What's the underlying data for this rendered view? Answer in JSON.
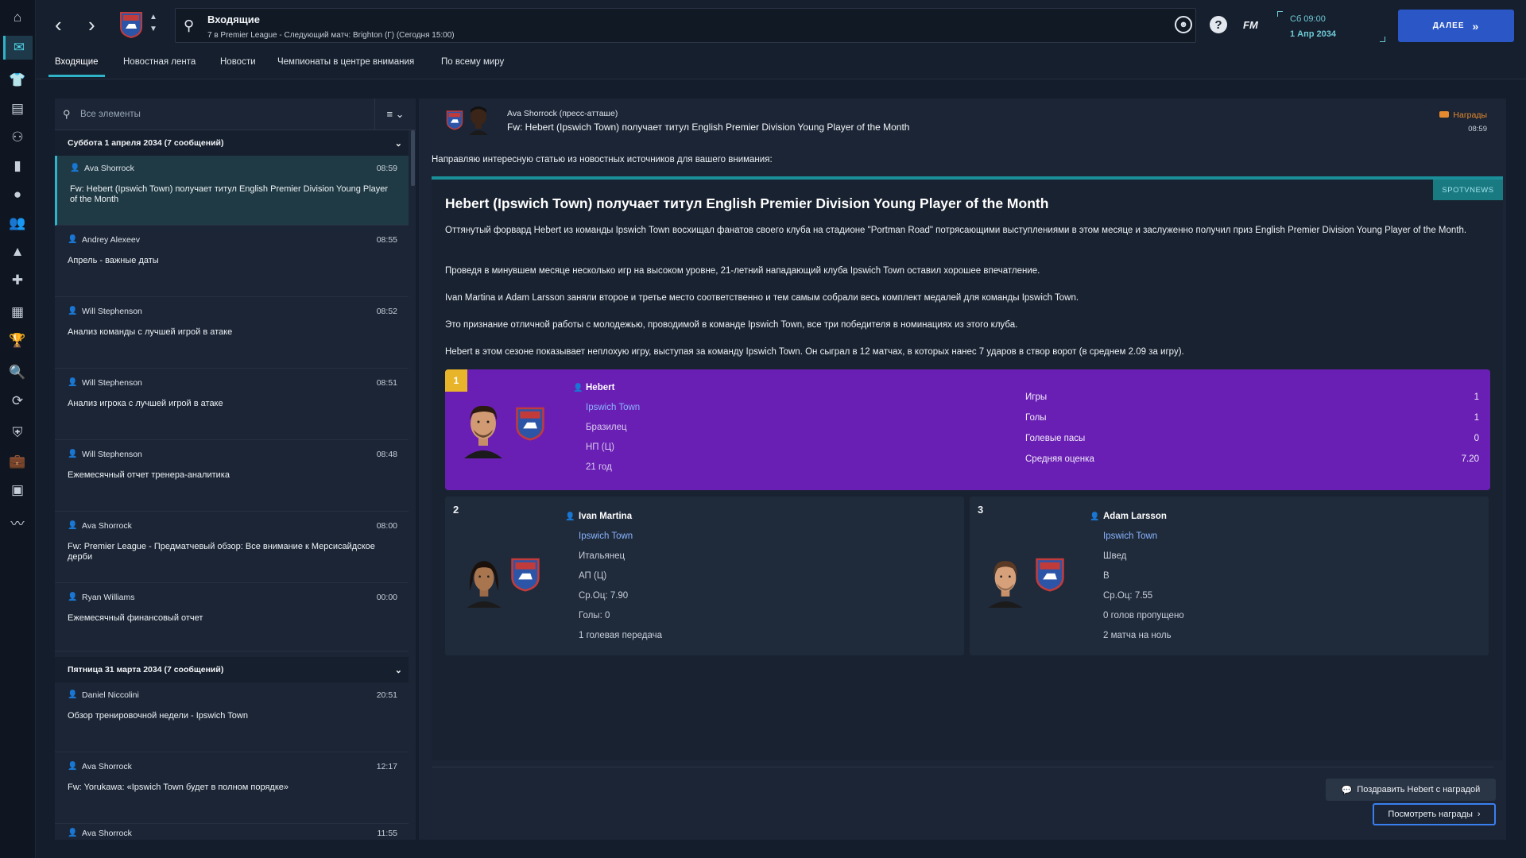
{
  "header": {
    "title": "Входящие",
    "subtitle": "7 в Premier League - Следующий матч: Brighton (Г) (Сегодня 15:00)",
    "fm_label": "FM",
    "datetime_line1": "Сб 09:00",
    "datetime_line2": "1 Апр 2034",
    "continue_label": "ДАЛЕЕ"
  },
  "tabs": [
    {
      "label": "Входящие"
    },
    {
      "label": "Новостная лента"
    },
    {
      "label": "Новости"
    },
    {
      "label": "Чемпионаты в центре внимания"
    },
    {
      "label": "По всему миру"
    }
  ],
  "inbox": {
    "search_placeholder": "Все элементы",
    "group1": "Суббота 1 апреля 2034 (7 сообщений)",
    "group2": "Пятница 31 марта 2034 (7 сообщений)",
    "messages": [
      {
        "sender": "Ava Shorrock",
        "time": "08:59",
        "subject": "Fw: Hebert (Ipswich Town) получает титул English Premier Division Young Player of the Month"
      },
      {
        "sender": "Andrey Alexeev",
        "time": "08:55",
        "subject": "Апрель - важные даты"
      },
      {
        "sender": "Will Stephenson",
        "time": "08:52",
        "subject": "Анализ команды с лучшей игрой в атаке"
      },
      {
        "sender": "Will Stephenson",
        "time": "08:51",
        "subject": "Анализ игрока с лучшей игрой в атаке"
      },
      {
        "sender": "Will Stephenson",
        "time": "08:48",
        "subject": "Ежемесячный отчет тренера-аналитика"
      },
      {
        "sender": "Ava Shorrock",
        "time": "08:00",
        "subject": "Fw: Premier League - Предматчевый обзор: Все внимание к Мерсисайдское дерби"
      },
      {
        "sender": "Ryan Williams",
        "time": "00:00",
        "subject": "Ежемесячный финансовый отчет"
      }
    ],
    "messages2": [
      {
        "sender": "Daniel Niccolini",
        "time": "20:51",
        "subject": "Обзор тренировочной недели - Ipswich Town"
      },
      {
        "sender": "Ava Shorrock",
        "time": "12:17",
        "subject": "Fw: Yorukawa: «Ipswich Town будет в полном порядке»"
      },
      {
        "sender": "Ava Shorrock",
        "time": "11:55",
        "subject": ""
      }
    ]
  },
  "message": {
    "sender": "Ava Shorrock  (пресс-атташе)",
    "subject": "Fw: Hebert (Ipswich Town) получает титул English Premier Division Young Player of the Month",
    "tag": "Награды",
    "time": "08:59",
    "intro": "Направляю интересную статью из новостных источников для вашего внимания:",
    "source": "SPOTVNEWS",
    "headline": "Hebert (Ipswich Town) получает титул English Premier Division Young Player of the Month",
    "p1": "Оттянутый форвард Hebert из команды Ipswich Town восхищал фанатов своего клуба на стадионе \"Portman Road\" потрясающими выступлениями в этом месяце и заслуженно получил приз English Premier Division Young Player of the Month.",
    "p2": "Проведя в минувшем месяце несколько игр на высоком уровне, 21-летний нападающий клуба Ipswich Town оставил хорошее впечатление.",
    "p3": "Ivan Martina и Adam Larsson заняли второе и третье место соответственно и тем самым собрали весь комплект медалей для команды Ipswich Town.",
    "p4": "Это признание отличной работы с молодежью, проводимой в команде Ipswich Town, все три победителя в номинациях из этого клуба.",
    "p5": "Hebert в этом сезоне показывает неплохую игру, выступая за команду Ipswich Town. Он сыграл в 12 матчах, в которых нанес 7 ударов в створ ворот (в среднем 2.09 за игру)."
  },
  "winner": {
    "rank": "1",
    "name": "Hebert",
    "club": "Ipswich Town",
    "nationality": "Бразилец",
    "position": "НП (Ц)",
    "age": "21 год",
    "stats": [
      {
        "label": "Игры",
        "value": "1"
      },
      {
        "label": "Голы",
        "value": "1"
      },
      {
        "label": "Голевые пасы",
        "value": "0"
      },
      {
        "label": "Средняя оценка",
        "value": "7.20"
      }
    ]
  },
  "second": {
    "rank": "2",
    "name": "Ivan Martina",
    "club": "Ipswich Town",
    "nationality": "Итальянец",
    "position": "АП (Ц)",
    "rating": "Ср.Оц: 7.90",
    "goals": "Голы: 0",
    "assists": "1 голевая передача"
  },
  "third": {
    "rank": "3",
    "name": "Adam Larsson",
    "club": "Ipswich Town",
    "nationality": "Швед",
    "position": "В",
    "rating": "Ср.Оц: 7.55",
    "conceded": "0 голов пропущено",
    "cleansheets": "2 матча на ноль"
  },
  "actions": {
    "congratulate": "Поздравить Hebert с наградой",
    "view_awards": "Посмотреть награды"
  },
  "colors": {
    "accent": "#2fb3c8",
    "winner_bg": "#6a1fb4",
    "continue_bg": "#2a56c6",
    "rank_gold": "#e8b42a"
  }
}
